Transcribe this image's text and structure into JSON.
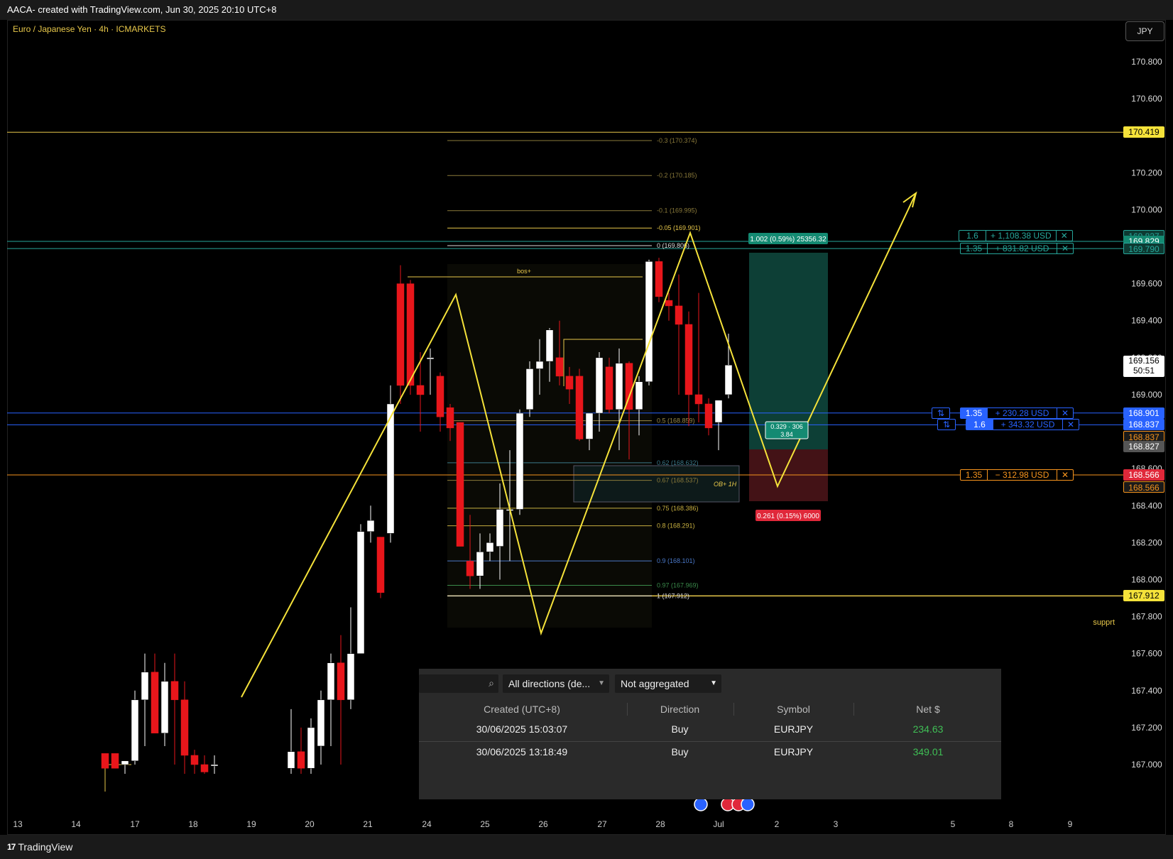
{
  "header": {
    "title": "AACA- created with TradingView.com, Jun 30, 2025 20:10 UTC+8"
  },
  "chart": {
    "symbol_title": "Euro / Japanese Yen · 4h · ICMARKETS",
    "currency": "JPY",
    "price_ticks": [
      "170.800",
      "170.600",
      "170.200",
      "170.000",
      "169.600",
      "169.400",
      "169.200",
      "169.000",
      "168.600",
      "168.400",
      "168.200",
      "168.000",
      "167.800",
      "167.600",
      "167.400",
      "167.200",
      "167.000"
    ],
    "time_ticks": [
      "13",
      "14",
      "17",
      "18",
      "19",
      "20",
      "21",
      "24",
      "25",
      "26",
      "27",
      "28",
      "Jul",
      "2",
      "3",
      "5",
      "8",
      "9"
    ],
    "axis_labels": {
      "resistance": "170.419",
      "tp_top": "169.837",
      "tp_mid": "169.829",
      "tp_low": "169.790",
      "current_price": "169.156",
      "countdown": "50:51",
      "entry1": "168.901",
      "entry2": "168.837",
      "entry2b": "168.837",
      "gray": "168.827",
      "sl": "168.566",
      "sl2": "168.566",
      "support": "167.912"
    },
    "fib_levels": [
      {
        "label": "-0.3 (170.374)",
        "price": 170.374,
        "color": "#8a7a3a"
      },
      {
        "label": "-0.2 (170.185)",
        "price": 170.185,
        "color": "#8a7a3a"
      },
      {
        "label": "-0.1 (169.995)",
        "price": 169.995,
        "color": "#8a7a3a"
      },
      {
        "label": "-0.05 (169.901)",
        "price": 169.901,
        "color": "#e8c84a"
      },
      {
        "label": "0 (169.806)",
        "price": 169.806,
        "color": "#dddddd"
      },
      {
        "label": "0.5 (168.859)",
        "price": 168.859,
        "color": "#9a8a4a"
      },
      {
        "label": "0.62 (168.632)",
        "price": 168.632,
        "color": "#3a7a8a"
      },
      {
        "label": "0.67 (168.537)",
        "price": 168.537,
        "color": "#8a7a3a"
      },
      {
        "label": "0.75 (168.386)",
        "price": 168.386,
        "color": "#c8b040"
      },
      {
        "label": "0.8 (168.291)",
        "price": 168.291,
        "color": "#c8b040"
      },
      {
        "label": "0.9 (168.101)",
        "price": 168.101,
        "color": "#4a78c8"
      },
      {
        "label": "0.97 (167.969)",
        "price": 167.969,
        "color": "#3a8a4a"
      },
      {
        "label": "1 (167.912)",
        "price": 167.912,
        "color": "#dddddd"
      }
    ],
    "annotations": {
      "bos": "bos+",
      "ob": "OB+ 1H",
      "support": "supprt",
      "tp_badge": "1.002 (0.59%) 25356.32",
      "sl_badge": "0.261 (0.15%) 6000",
      "rr_badge_line1": "0.329 · 306",
      "rr_badge_line2": "3.84"
    },
    "positions": [
      {
        "qty": "1.6",
        "pnl": "+ 1,108.38 USD",
        "close": "✕"
      },
      {
        "qty": "1.35",
        "pnl": "+ 831.82 USD",
        "close": "✕"
      },
      {
        "qty": "1.35",
        "pnl": "+ 230.28 USD",
        "close": "✕",
        "rev": "⇅"
      },
      {
        "qty": "1.6",
        "pnl": "+ 343.32 USD",
        "close": "✕",
        "rev": "⇅"
      },
      {
        "qty": "1.35",
        "pnl": "− 312.98 USD",
        "close": "✕"
      }
    ],
    "colors": {
      "bull": "#ffffff",
      "bear": "#e8161b",
      "yellow": "#f5e23a",
      "blue": "#2962ff",
      "teal": "#26a69a",
      "red": "#f23645",
      "orange": "#f7941d"
    }
  },
  "orders_panel": {
    "filter_direction": "All directions (de...",
    "filter_aggregation": "Not aggregated",
    "columns": [
      "Created (UTC+8)",
      "Direction",
      "Symbol",
      "Net $"
    ],
    "rows": [
      {
        "created": "30/06/2025 15:03:07",
        "direction": "Buy",
        "symbol": "EURJPY",
        "net": "234.63"
      },
      {
        "created": "30/06/2025 13:18:49",
        "direction": "Buy",
        "symbol": "EURJPY",
        "net": "349.01"
      }
    ]
  },
  "footer": {
    "brand": "TradingView",
    "logo": "17"
  }
}
